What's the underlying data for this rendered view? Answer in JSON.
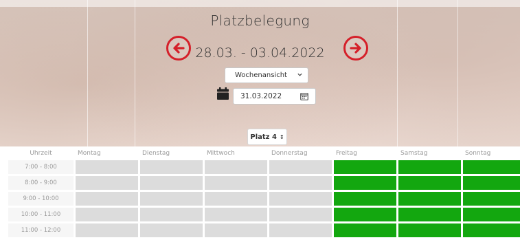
{
  "title": "Platzbelegung",
  "date_range": "28.03. - 03.04.2022",
  "view_select": {
    "value": "Wochenansicht"
  },
  "date_input": {
    "value": "31.03.2022"
  },
  "court_select": {
    "value": "Platz 4"
  },
  "colors": {
    "nav_red": "#d5202a",
    "free": "#13a70f",
    "unavailable": "#dcdcdc"
  },
  "schedule": {
    "time_header": "Uhrzeit",
    "days": [
      "Montag",
      "Dienstag",
      "Mittwoch",
      "Donnerstag",
      "Freitag",
      "Samstag",
      "Sonntag"
    ],
    "rows": [
      {
        "time": "7:00 - 8:00",
        "status": [
          "unavailable",
          "unavailable",
          "unavailable",
          "unavailable",
          "free",
          "free",
          "free"
        ]
      },
      {
        "time": "8:00 - 9:00",
        "status": [
          "unavailable",
          "unavailable",
          "unavailable",
          "unavailable",
          "free",
          "free",
          "free"
        ]
      },
      {
        "time": "9:00 - 10:00",
        "status": [
          "unavailable",
          "unavailable",
          "unavailable",
          "unavailable",
          "free",
          "free",
          "free"
        ]
      },
      {
        "time": "10:00 - 11:00",
        "status": [
          "unavailable",
          "unavailable",
          "unavailable",
          "unavailable",
          "free",
          "free",
          "free"
        ]
      },
      {
        "time": "11:00 - 12:00",
        "status": [
          "unavailable",
          "unavailable",
          "unavailable",
          "unavailable",
          "free",
          "free",
          "free"
        ]
      }
    ]
  }
}
